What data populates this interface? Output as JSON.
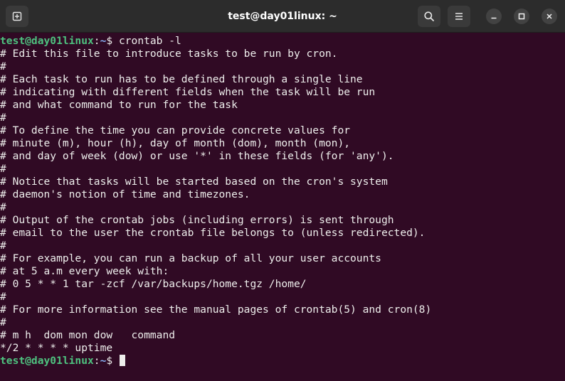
{
  "window": {
    "title": "test@day01linux: ~"
  },
  "icons": {
    "new_tab": "new-tab-icon",
    "search": "search-icon",
    "menu": "hamburger-menu-icon",
    "minimize": "minimize-icon",
    "maximize": "maximize-icon",
    "close": "close-icon"
  },
  "colors": {
    "terminal_bg": "#300a24",
    "prompt_user": "#4ec27f",
    "prompt_path": "#8ab4f8",
    "text": "#eeeeec"
  },
  "prompt": {
    "user_host": "test@day01linux",
    "colon": ":",
    "path": "~",
    "symbol": "$ "
  },
  "first_command": "crontab -l",
  "output_lines": [
    "# Edit this file to introduce tasks to be run by cron.",
    "#",
    "# Each task to run has to be defined through a single line",
    "# indicating with different fields when the task will be run",
    "# and what command to run for the task",
    "#",
    "# To define the time you can provide concrete values for",
    "# minute (m), hour (h), day of month (dom), month (mon),",
    "# and day of week (dow) or use '*' in these fields (for 'any').",
    "#",
    "# Notice that tasks will be started based on the cron's system",
    "# daemon's notion of time and timezones.",
    "#",
    "# Output of the crontab jobs (including errors) is sent through",
    "# email to the user the crontab file belongs to (unless redirected).",
    "#",
    "# For example, you can run a backup of all your user accounts",
    "# at 5 a.m every week with:",
    "# 0 5 * * 1 tar -zcf /var/backups/home.tgz /home/",
    "#",
    "# For more information see the manual pages of crontab(5) and cron(8)",
    "#",
    "# m h  dom mon dow   command",
    "*/2 * * * * uptime"
  ]
}
